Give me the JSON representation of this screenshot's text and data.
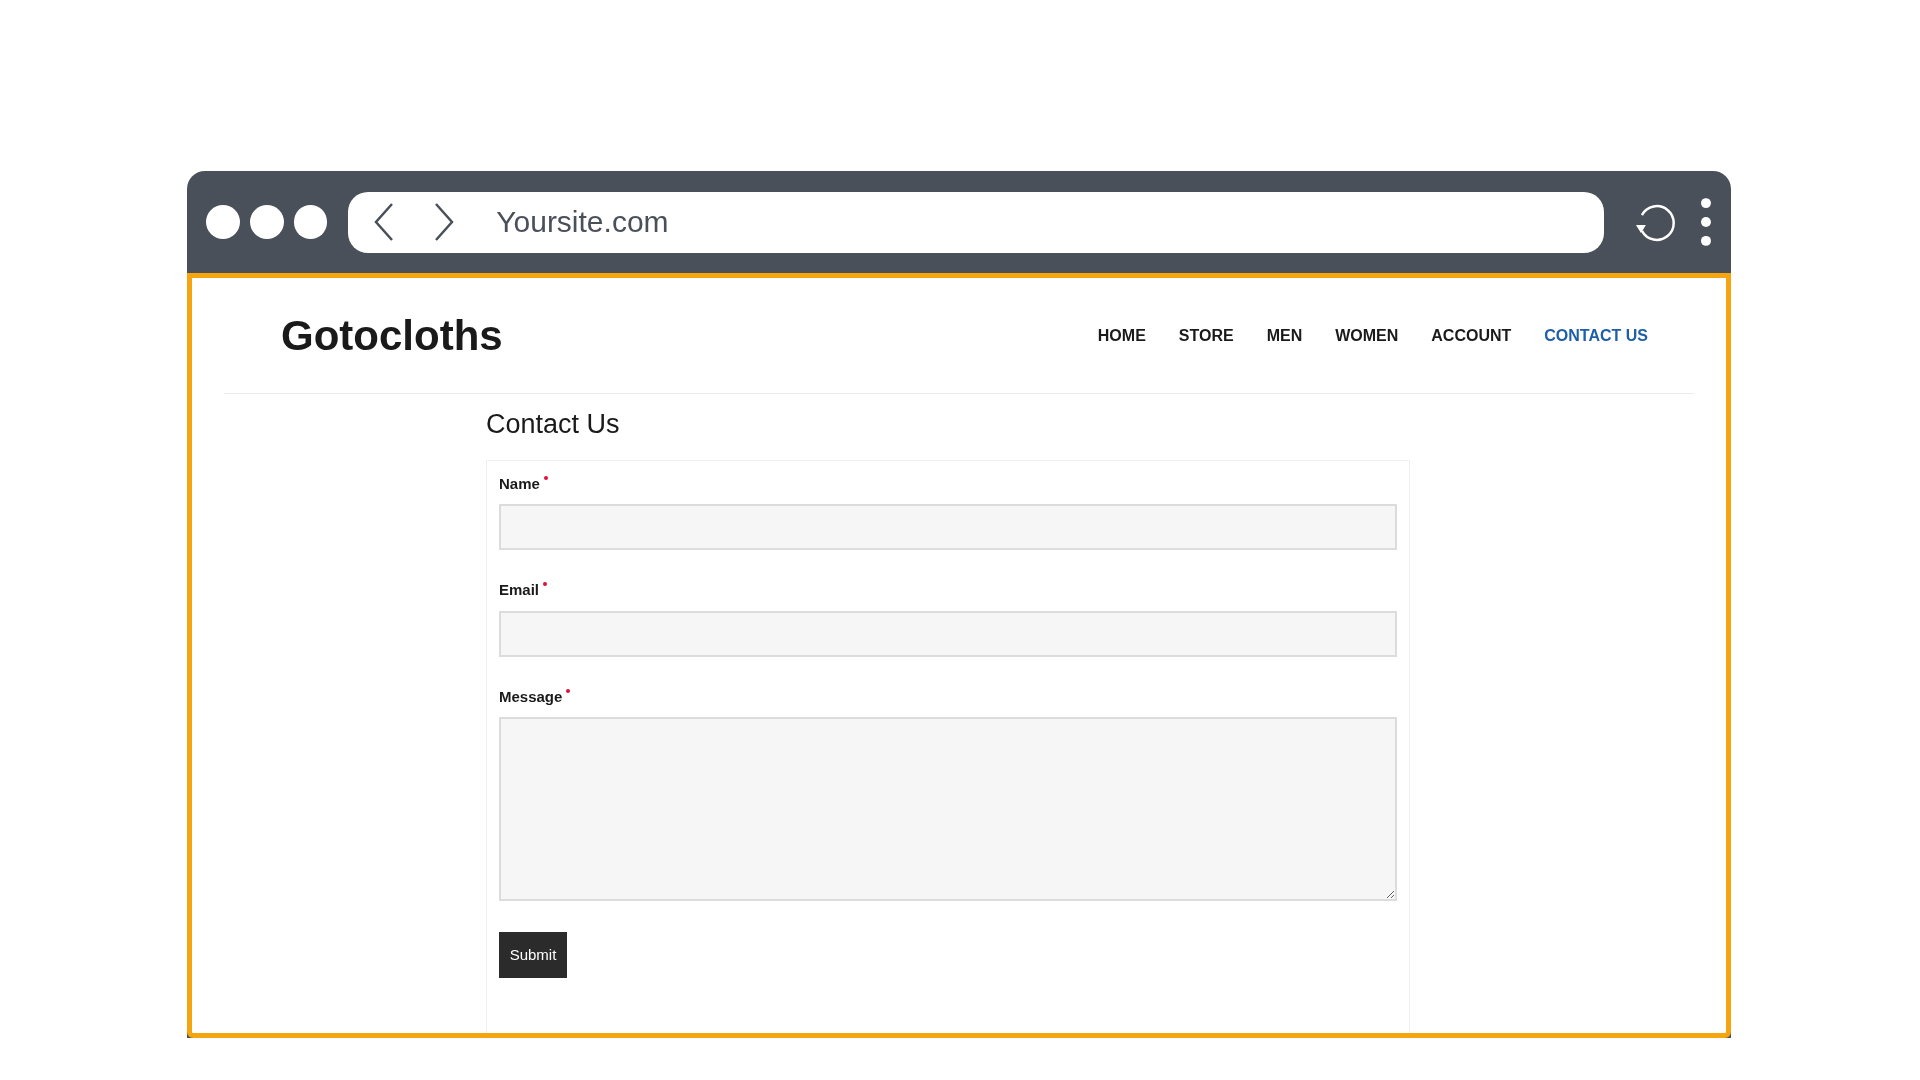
{
  "browser": {
    "url": "Yoursite.com"
  },
  "site": {
    "logo": "Gotocloths",
    "nav": [
      {
        "label": "HOME",
        "selected": false
      },
      {
        "label": "STORE",
        "selected": false
      },
      {
        "label": "MEN",
        "selected": false
      },
      {
        "label": "WOMEN",
        "selected": false
      },
      {
        "label": "ACCOUNT",
        "selected": false
      },
      {
        "label": "CONTACT US",
        "selected": true
      }
    ]
  },
  "page_title": "Contact Us",
  "form": {
    "fields": [
      {
        "label": "Name",
        "required": true,
        "kind": "input"
      },
      {
        "label": "Email",
        "required": true,
        "kind": "input"
      },
      {
        "label": "Message",
        "required": true,
        "kind": "textarea"
      }
    ],
    "submit": "Submit"
  }
}
